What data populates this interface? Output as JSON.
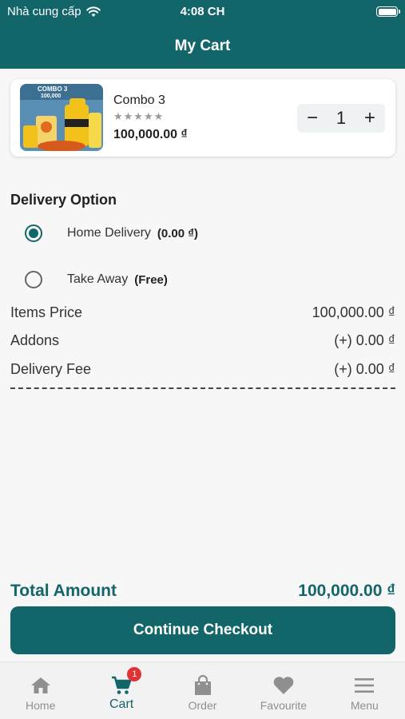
{
  "status_bar": {
    "carrier": "Nhà cung cấp",
    "time": "4:08 CH"
  },
  "app_bar": {
    "title": "My Cart"
  },
  "cart_item": {
    "name": "Combo 3",
    "rating_stars": 5,
    "rating_value": 0,
    "price": "100,000.00 ₫",
    "quantity": "1",
    "image_caption": "COMBO 3 100,000"
  },
  "delivery": {
    "title": "Delivery Option",
    "options": [
      {
        "label": "Home Delivery",
        "fee": "(0.00 ₫)",
        "selected": true
      },
      {
        "label": "Take Away",
        "fee": "(Free)",
        "selected": false
      }
    ]
  },
  "summary": {
    "items_price_label": "Items Price",
    "items_price_value": "100,000.00 ₫",
    "addons_label": "Addons",
    "addons_value": "(+) 0.00 ₫",
    "delivery_fee_label": "Delivery Fee",
    "delivery_fee_value": "(+) 0.00 ₫"
  },
  "total": {
    "label": "Total Amount",
    "value": "100,000.00 ₫"
  },
  "checkout_button": "Continue Checkout",
  "nav": {
    "items": [
      {
        "label": "Home",
        "icon": "home-icon"
      },
      {
        "label": "Cart",
        "icon": "cart-icon",
        "badge": "1",
        "active": true
      },
      {
        "label": "Order",
        "icon": "shopping-bag-icon"
      },
      {
        "label": "Favourite",
        "icon": "heart-icon"
      },
      {
        "label": "Menu",
        "icon": "menu-icon"
      }
    ]
  },
  "colors": {
    "primary": "#12666a",
    "badge": "#e03434",
    "inactive": "#8f8f8f"
  }
}
